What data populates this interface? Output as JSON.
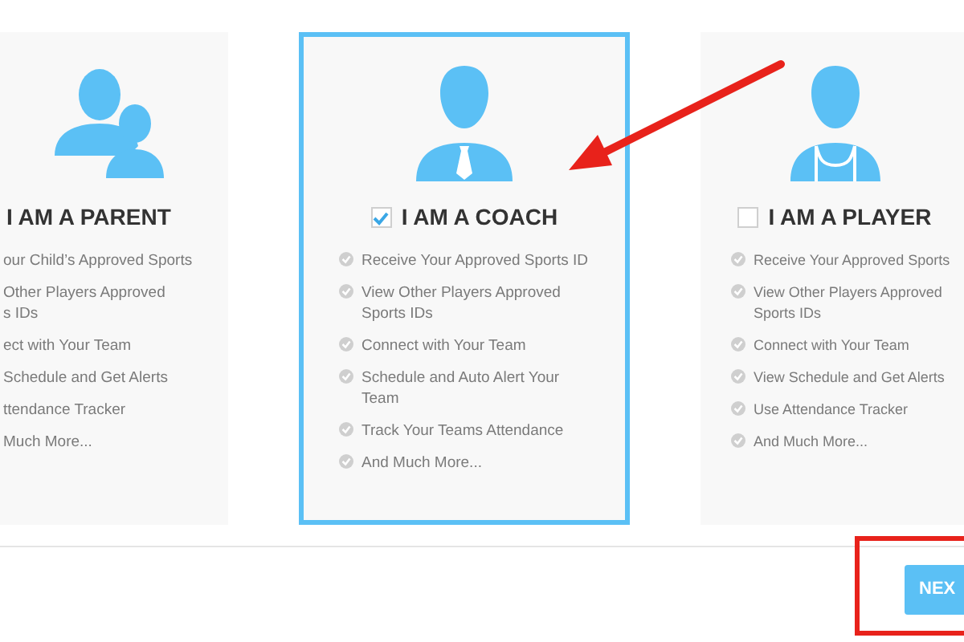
{
  "cards": [
    {
      "kind": "parent",
      "title": "I AM A PARENT",
      "selected": false,
      "items": [
        "our Child’s Approved Sports",
        "Other Players Approved\ns IDs",
        "ect with Your Team",
        "Schedule and Get Alerts",
        "ttendance Tracker",
        "Much More..."
      ]
    },
    {
      "kind": "coach",
      "title": "I AM A COACH",
      "checked": true,
      "selected": true,
      "items": [
        "Receive Your Approved Sports ID",
        "View Other Players Approved\nSports IDs",
        "Connect with Your Team",
        "Schedule and Auto Alert Your\nTeam",
        "Track Your Teams Attendance",
        "And Much More..."
      ]
    },
    {
      "kind": "player",
      "title": "I AM A PLAYER",
      "checked": false,
      "selected": false,
      "items": [
        "Receive Your Approved Sports",
        "View Other Players Approved\nSports IDs",
        "Connect with Your Team",
        "View Schedule and Get Alerts",
        "Use Attendance Tracker",
        "And Much More..."
      ]
    }
  ],
  "next_button": {
    "label": "NEX"
  }
}
